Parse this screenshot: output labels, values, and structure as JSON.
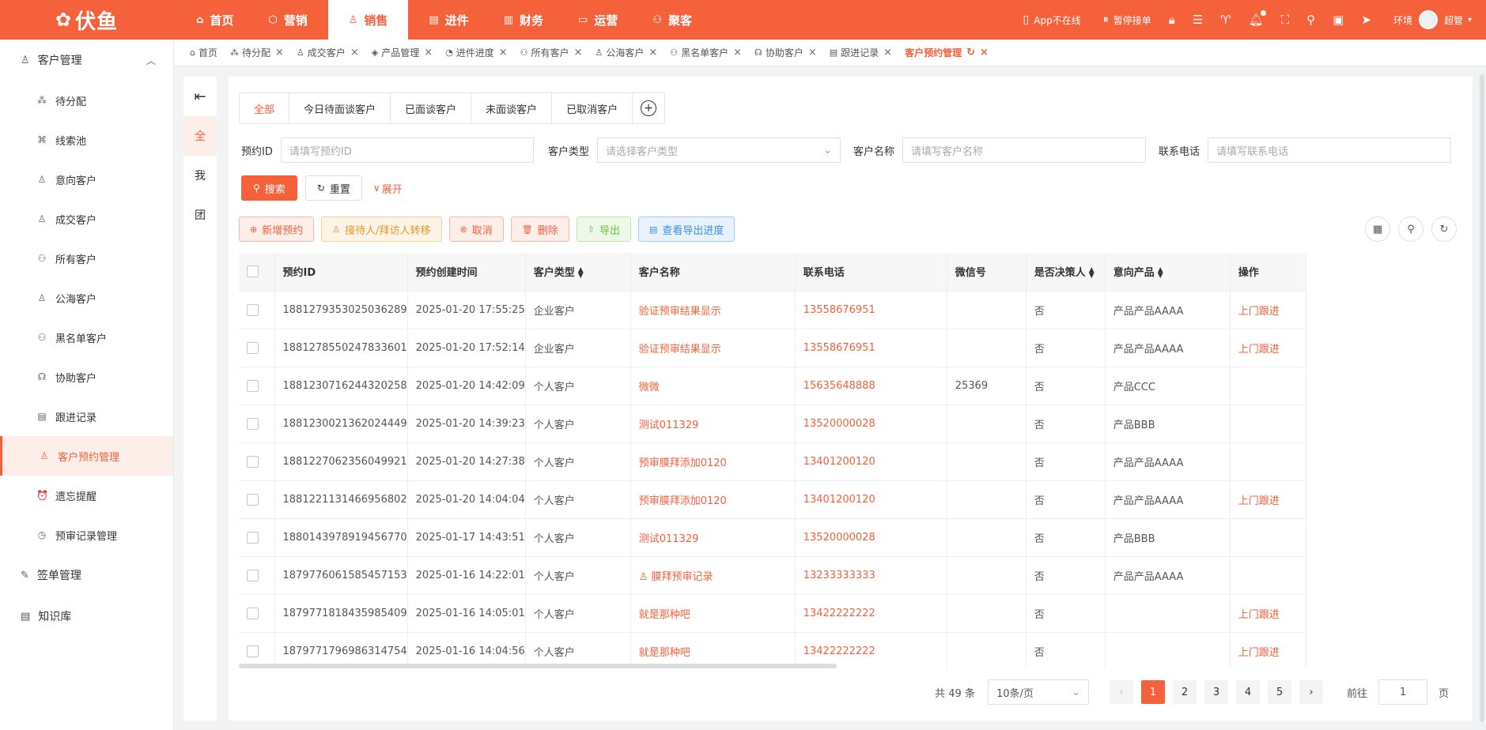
{
  "brand": {
    "logo": "伏鱼",
    "accent": "#f5613b"
  },
  "topnav": [
    {
      "label": "首页",
      "icon": "home-icon",
      "glyph": "⌂"
    },
    {
      "label": "营销",
      "icon": "marketing-icon",
      "glyph": "⬡"
    },
    {
      "label": "销售",
      "icon": "sales-icon",
      "glyph": "♙",
      "active": true
    },
    {
      "label": "进件",
      "icon": "apply-icon",
      "glyph": "▤"
    },
    {
      "label": "财务",
      "icon": "finance-icon",
      "glyph": "▥"
    },
    {
      "label": "运营",
      "icon": "operation-icon",
      "glyph": "▭"
    },
    {
      "label": "聚客",
      "icon": "customers-icon",
      "glyph": "⚇"
    }
  ],
  "topright": {
    "app_status": "App不在线",
    "pause": "暂停接单",
    "env": "环境",
    "user": "超管"
  },
  "sidebar": {
    "group_customer": "客户管理",
    "items": [
      {
        "label": "待分配",
        "icon": "allocate-icon",
        "glyph": "⁂"
      },
      {
        "label": "线索池",
        "icon": "lead-pool-icon",
        "glyph": "⌘"
      },
      {
        "label": "意向客户",
        "icon": "intent-customer-icon",
        "glyph": "♙"
      },
      {
        "label": "成交客户",
        "icon": "deal-customer-icon",
        "glyph": "♙"
      },
      {
        "label": "所有客户",
        "icon": "all-customer-icon",
        "glyph": "⚇"
      },
      {
        "label": "公海客户",
        "icon": "public-customer-icon",
        "glyph": "♙"
      },
      {
        "label": "黑名单客户",
        "icon": "blacklist-icon",
        "glyph": "⚇"
      },
      {
        "label": "协助客户",
        "icon": "assist-icon",
        "glyph": "☊"
      },
      {
        "label": "跟进记录",
        "icon": "follow-record-icon",
        "glyph": "▤"
      },
      {
        "label": "客户预约管理",
        "icon": "appointment-icon",
        "glyph": "♙",
        "active": true
      },
      {
        "label": "遗忘提醒",
        "icon": "alarm-icon",
        "glyph": "⏰"
      },
      {
        "label": "预审记录管理",
        "icon": "precheck-icon",
        "glyph": "◷"
      }
    ],
    "group_sign": "签单管理",
    "group_kb": "知识库"
  },
  "tabs": [
    {
      "label": "首页",
      "glyph": "⌂",
      "closable": false
    },
    {
      "label": "待分配",
      "glyph": "⁂",
      "closable": true
    },
    {
      "label": "成交客户",
      "glyph": "♙",
      "closable": true
    },
    {
      "label": "产品管理",
      "glyph": "◈",
      "closable": true
    },
    {
      "label": "进件进度",
      "glyph": "◔",
      "closable": true
    },
    {
      "label": "所有客户",
      "glyph": "⚇",
      "closable": true
    },
    {
      "label": "公海客户",
      "glyph": "♙",
      "closable": true
    },
    {
      "label": "黑名单客户",
      "glyph": "⚇",
      "closable": true
    },
    {
      "label": "协助客户",
      "glyph": "☊",
      "closable": true
    },
    {
      "label": "跟进记录",
      "glyph": "▤",
      "closable": true
    },
    {
      "label": "客户预约管理",
      "glyph": "",
      "closable": true,
      "active": true
    }
  ],
  "leftpanel": {
    "all": "全",
    "mine": "我",
    "team": "团"
  },
  "subtabs": [
    "全部",
    "今日待面谈客户",
    "已面谈客户",
    "未面谈客户",
    "已取消客户"
  ],
  "filters": {
    "appt_id_label": "预约ID",
    "appt_id_ph": "请填写预约ID",
    "type_label": "客户类型",
    "type_ph": "请选择客户类型",
    "name_label": "客户名称",
    "name_ph": "请填写客户名称",
    "phone_label": "联系电话",
    "phone_ph": "请填写联系电话"
  },
  "buttons": {
    "search": "搜索",
    "reset": "重置",
    "expand": "展开"
  },
  "actions": {
    "add": "新增预约",
    "transfer": "接待人/拜访人转移",
    "cancel": "取消",
    "delete": "删除",
    "export": "导出",
    "export_progress": "查看导出进度"
  },
  "columns": [
    "预约ID",
    "预约创建时间",
    "客户类型",
    "客户名称",
    "联系电话",
    "微信号",
    "是否决策人",
    "意向产品",
    "操作"
  ],
  "rows": [
    {
      "id": "1881279353025036289",
      "time": "2025-01-20 17:55:25",
      "type": "企业客户",
      "name": "验证预审结果显示",
      "phone": "13558676951",
      "wechat": "",
      "decider": "否",
      "product": "产品产品AAAA",
      "op": "上门跟进"
    },
    {
      "id": "1881278550247833601",
      "time": "2025-01-20 17:52:14",
      "type": "企业客户",
      "name": "验证预审结果显示",
      "phone": "13558676951",
      "wechat": "",
      "decider": "否",
      "product": "产品产品AAAA",
      "op": "上门跟进"
    },
    {
      "id": "1881230716244320258",
      "time": "2025-01-20 14:42:09",
      "type": "个人客户",
      "name": "微微",
      "phone": "15635648888",
      "wechat": "25369",
      "decider": "否",
      "product": "产品CCC",
      "op": ""
    },
    {
      "id": "1881230021362024449",
      "time": "2025-01-20 14:39:23",
      "type": "个人客户",
      "name": "测试011329",
      "phone": "13520000028",
      "wechat": "",
      "decider": "否",
      "product": "产品BBB",
      "op": ""
    },
    {
      "id": "1881227062356049921",
      "time": "2025-01-20 14:27:38",
      "type": "个人客户",
      "name": "预审膜拜添加0120",
      "phone": "13401200120",
      "wechat": "",
      "decider": "否",
      "product": "产品产品AAAA",
      "op": ""
    },
    {
      "id": "1881221131466956802",
      "time": "2025-01-20 14:04:04",
      "type": "个人客户",
      "name": "预审膜拜添加0120",
      "phone": "13401200120",
      "wechat": "",
      "decider": "否",
      "product": "产品产品AAAA",
      "op": "上门跟进"
    },
    {
      "id": "1880143978919456770",
      "time": "2025-01-17 14:43:51",
      "type": "个人客户",
      "name": "测试011329",
      "phone": "13520000028",
      "wechat": "",
      "decider": "否",
      "product": "产品BBB",
      "op": ""
    },
    {
      "id": "1879776061585457153",
      "time": "2025-01-16 14:22:01",
      "type": "个人客户",
      "name": "膜拜预审记录",
      "phone": "13233333333",
      "wechat": "",
      "decider": "否",
      "product": "产品产品AAAA",
      "op": "",
      "icon": true
    },
    {
      "id": "1879771818435985409",
      "time": "2025-01-16 14:05:01",
      "type": "个人客户",
      "name": "就是那种吧",
      "phone": "13422222222",
      "wechat": "",
      "decider": "否",
      "product": "",
      "op": "上门跟进"
    },
    {
      "id": "1879771796986314754",
      "time": "2025-01-16 14:04:56",
      "type": "个人客户",
      "name": "就是那种吧",
      "phone": "13422222222",
      "wechat": "",
      "decider": "否",
      "product": "",
      "op": "上门跟进"
    }
  ],
  "pager": {
    "total": "共 49 条",
    "size": "10条/页",
    "pages": [
      "1",
      "2",
      "3",
      "4",
      "5"
    ],
    "goto": "前往",
    "goto_value": "1",
    "page_unit": "页"
  }
}
